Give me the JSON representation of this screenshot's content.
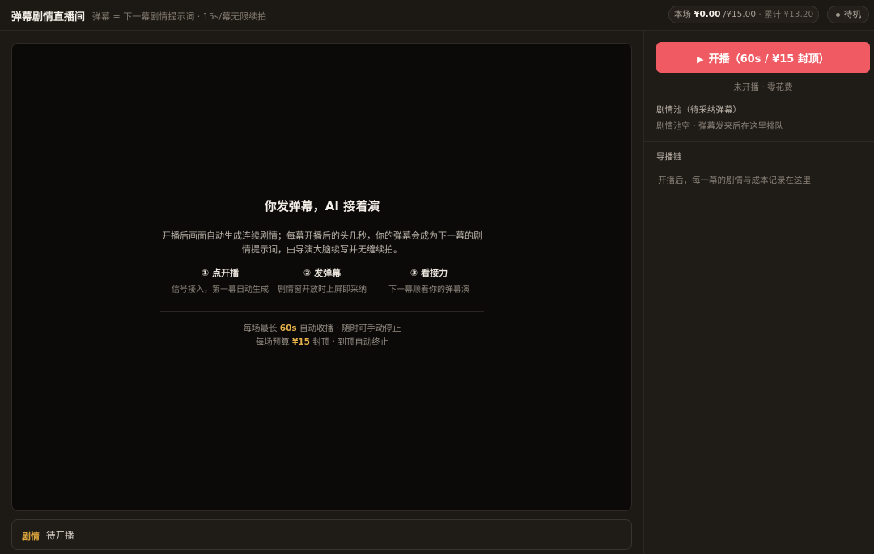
{
  "header": {
    "title": "弹幕剧情直播间",
    "subtitle": "弹幕 = 下一幕剧情提示词 · 15s/幕无限续拍",
    "cost": {
      "current_label": "本场",
      "current_value": "¥0.00",
      "budget": "/¥15.00",
      "separator": "·",
      "total_label": "累计",
      "total_value": "¥13.20"
    },
    "status": "待机"
  },
  "stage": {
    "title": "你发弹幕，AI 接着演",
    "body": "开播后画面自动生成连续剧情；每幕开播后的头几秒，你的弹幕会成为下一幕的剧情提示词，由导演大脑续写并无缝续拍。",
    "steps": [
      {
        "title": "① 点开播",
        "desc": "信号接入，第一幕自动生成"
      },
      {
        "title": "② 发弹幕",
        "desc": "剧情窗开放时上屏即采纳"
      },
      {
        "title": "③ 看接力",
        "desc": "下一幕顺着你的弹幕演"
      }
    ],
    "footer": {
      "line1_prefix": "每场最长",
      "line1_value": "60s",
      "line1_suffix": "自动收播 · 随时可手动停止",
      "line2_prefix": "每场预算",
      "line2_value": "¥15",
      "line2_suffix": "封顶 · 到顶自动终止"
    }
  },
  "story_bar": {
    "tag": "剧情",
    "text": "待开播"
  },
  "sidebar": {
    "start_button": "开播（60s / ¥15 封顶）",
    "start_status": "未开播 · 零花费",
    "pool_title": "剧情池（待采纳弹幕）",
    "pool_desc": "剧情池空 · 弹幕发来后在这里排队",
    "chain_title": "导播链",
    "chain_empty": "开播后，每一幕的剧情与成本记录在这里"
  },
  "colors": {
    "accent": "#f05a63",
    "highlight": "#e4b04a",
    "stage_bg": "#0b0a09"
  }
}
